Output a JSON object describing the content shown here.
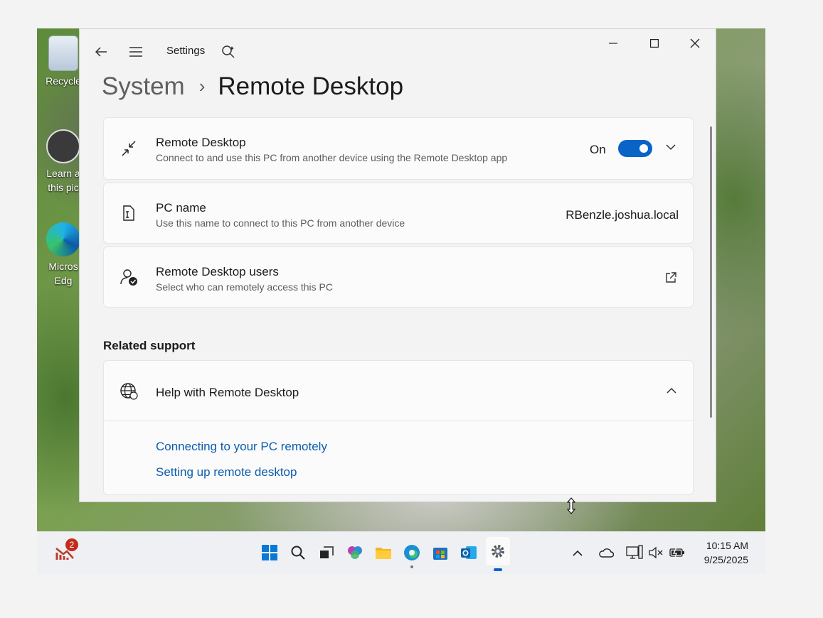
{
  "desktop": {
    "icons": [
      {
        "label_line1": "Recycle",
        "label_line2": ""
      },
      {
        "label_line1": "Learn a",
        "label_line2": "this pic"
      },
      {
        "label_line1": "Micros",
        "label_line2": "Edg"
      }
    ]
  },
  "window": {
    "app_title": "Settings",
    "breadcrumb": {
      "parent": "System",
      "separator": "›",
      "current": "Remote Desktop"
    }
  },
  "cards": {
    "remote_desktop": {
      "title": "Remote Desktop",
      "subtitle": "Connect to and use this PC from another device using the Remote Desktop app",
      "toggle_label": "On",
      "toggle_on": true
    },
    "pc_name": {
      "title": "PC name",
      "subtitle": "Use this name to connect to this PC from another device",
      "value": "RBenzle.joshua.local"
    },
    "users": {
      "title": "Remote Desktop users",
      "subtitle": "Select who can remotely access this PC"
    }
  },
  "related_support": {
    "title": "Related support",
    "help_title": "Help with Remote Desktop",
    "links": [
      "Connecting to your PC remotely",
      "Setting up remote desktop"
    ]
  },
  "taskbar": {
    "notification_badge": "2",
    "time": "10:15 AM",
    "date": "9/25/2025",
    "accent": "#0a63c7"
  }
}
